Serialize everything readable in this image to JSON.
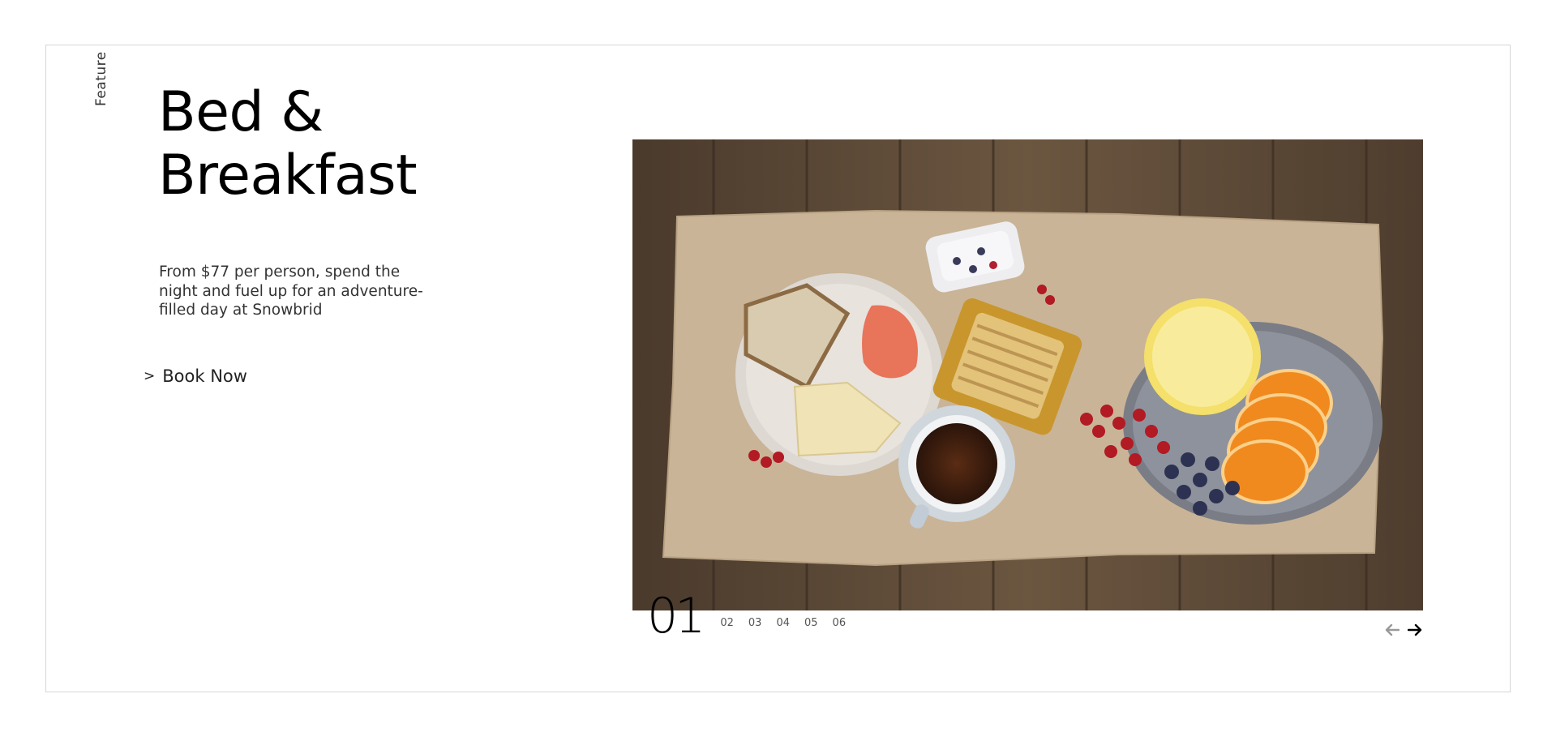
{
  "section": {
    "vertical_label": "Feature",
    "title_line1": "Bed &",
    "title_line2": "Breakfast",
    "description": "From $77 per person, spend the night and fuel up for an adventure-filled day at Snowbrid",
    "cta_label": "Book Now",
    "cta_chevron": ">"
  },
  "slider": {
    "current": "01",
    "pages": [
      "02",
      "03",
      "04",
      "05",
      "06"
    ],
    "prev_icon": "arrow-left-icon",
    "next_icon": "arrow-right-icon"
  },
  "colors": {
    "frame_border": "#d6d6d6",
    "text_primary": "#000000",
    "text_secondary": "#333333",
    "arrow_disabled": "#999999",
    "arrow_active": "#000000"
  }
}
